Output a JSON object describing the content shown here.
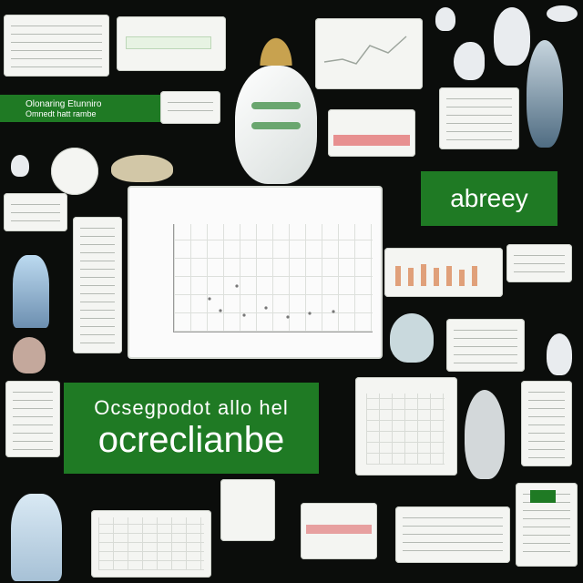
{
  "banners": {
    "center_line1": "Ocsegpodot allo hel",
    "center_line2": "ocreclianbe",
    "right_word": "abreey",
    "left_line1": "Olonaring Etunniro",
    "left_line2": "Omnedt hatt rambe"
  },
  "colors": {
    "green": "#1f7a24",
    "background": "#0b0d0b",
    "card": "#f4f5f2"
  }
}
